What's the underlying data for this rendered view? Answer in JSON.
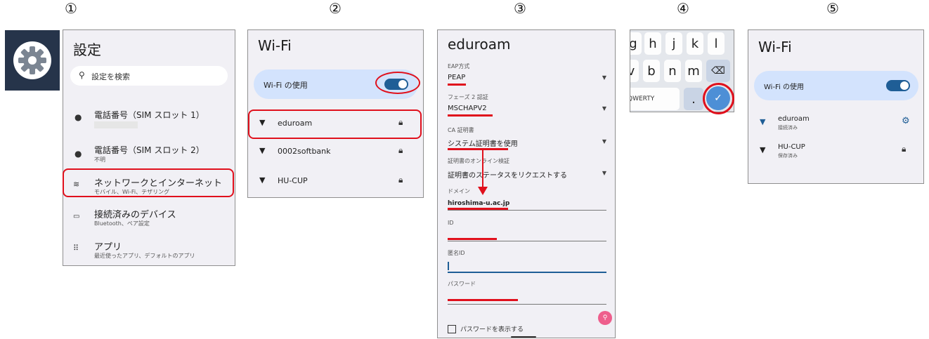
{
  "steps": [
    "①",
    "②",
    "③",
    "④",
    "⑤"
  ],
  "panel1": {
    "title": "設定",
    "search_placeholder": "設定を検索",
    "items": [
      {
        "label": "電話番号（SIM スロット 1）",
        "sub": ""
      },
      {
        "label": "電話番号（SIM スロット 2）",
        "sub": "不明"
      },
      {
        "label": "ネットワークとインターネット",
        "sub": "モバイル、Wi-Fi、テザリング"
      },
      {
        "label": "接続済みのデバイス",
        "sub": "Bluetooth、ペア設定"
      },
      {
        "label": "アプリ",
        "sub": "最近使ったアプリ、デフォルトのアプリ"
      }
    ]
  },
  "panel2": {
    "title": "Wi-Fi",
    "wifi_toggle_label": "Wi-Fi の使用",
    "networks": [
      "eduroam",
      "0002softbank",
      "HU-CUP"
    ]
  },
  "panel3": {
    "title": "eduroam",
    "eap_label": "EAP方式",
    "eap_value": "PEAP",
    "phase2_label": "フェーズ 2 認証",
    "phase2_value": "MSCHAPV2",
    "ca_label": "CA 証明書",
    "ca_value": "システム証明書を使用",
    "online_label": "証明書のオンライン検証",
    "online_value": "証明書のステータスをリクエストする",
    "domain_label": "ドメイン",
    "domain_value": "hiroshima-u.ac.jp",
    "id_label": "ID",
    "anon_label": "匿名ID",
    "password_label": "パスワード",
    "show_password_label": "パスワードを表示する"
  },
  "panel4": {
    "row1": [
      "g",
      "h",
      "j",
      "k",
      "l"
    ],
    "row2": [
      "v",
      "b",
      "n",
      "m"
    ],
    "qwerty_label": "QWERTY",
    "period": ".",
    "confirm_glyph": "✓"
  },
  "panel5": {
    "title": "Wi-Fi",
    "wifi_toggle_label": "Wi-Fi の使用",
    "networks": [
      {
        "name": "eduroam",
        "status": "接続済み"
      },
      {
        "name": "HU-CUP",
        "status": "保存済み"
      }
    ]
  },
  "colors": {
    "accent_red": "#e0101c",
    "toggle_blue": "#1f5e96",
    "highlight_blue": "#d3e3fd",
    "fab_pink": "#ee5e8c"
  }
}
